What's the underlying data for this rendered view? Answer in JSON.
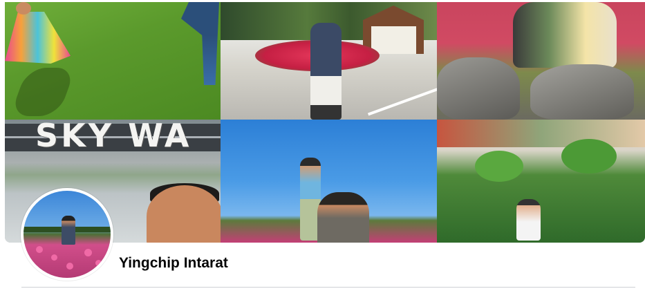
{
  "cover": {
    "tiles": [
      {
        "name": "cover-photo-lawn"
      },
      {
        "name": "cover-photo-flowerbed"
      },
      {
        "name": "cover-photo-rocks"
      },
      {
        "name": "cover-photo-skywalk",
        "sign_text": "SKY WA"
      },
      {
        "name": "cover-photo-sky-lift"
      },
      {
        "name": "cover-photo-plants"
      }
    ]
  },
  "profile": {
    "name": "Yingchip Intarat"
  }
}
